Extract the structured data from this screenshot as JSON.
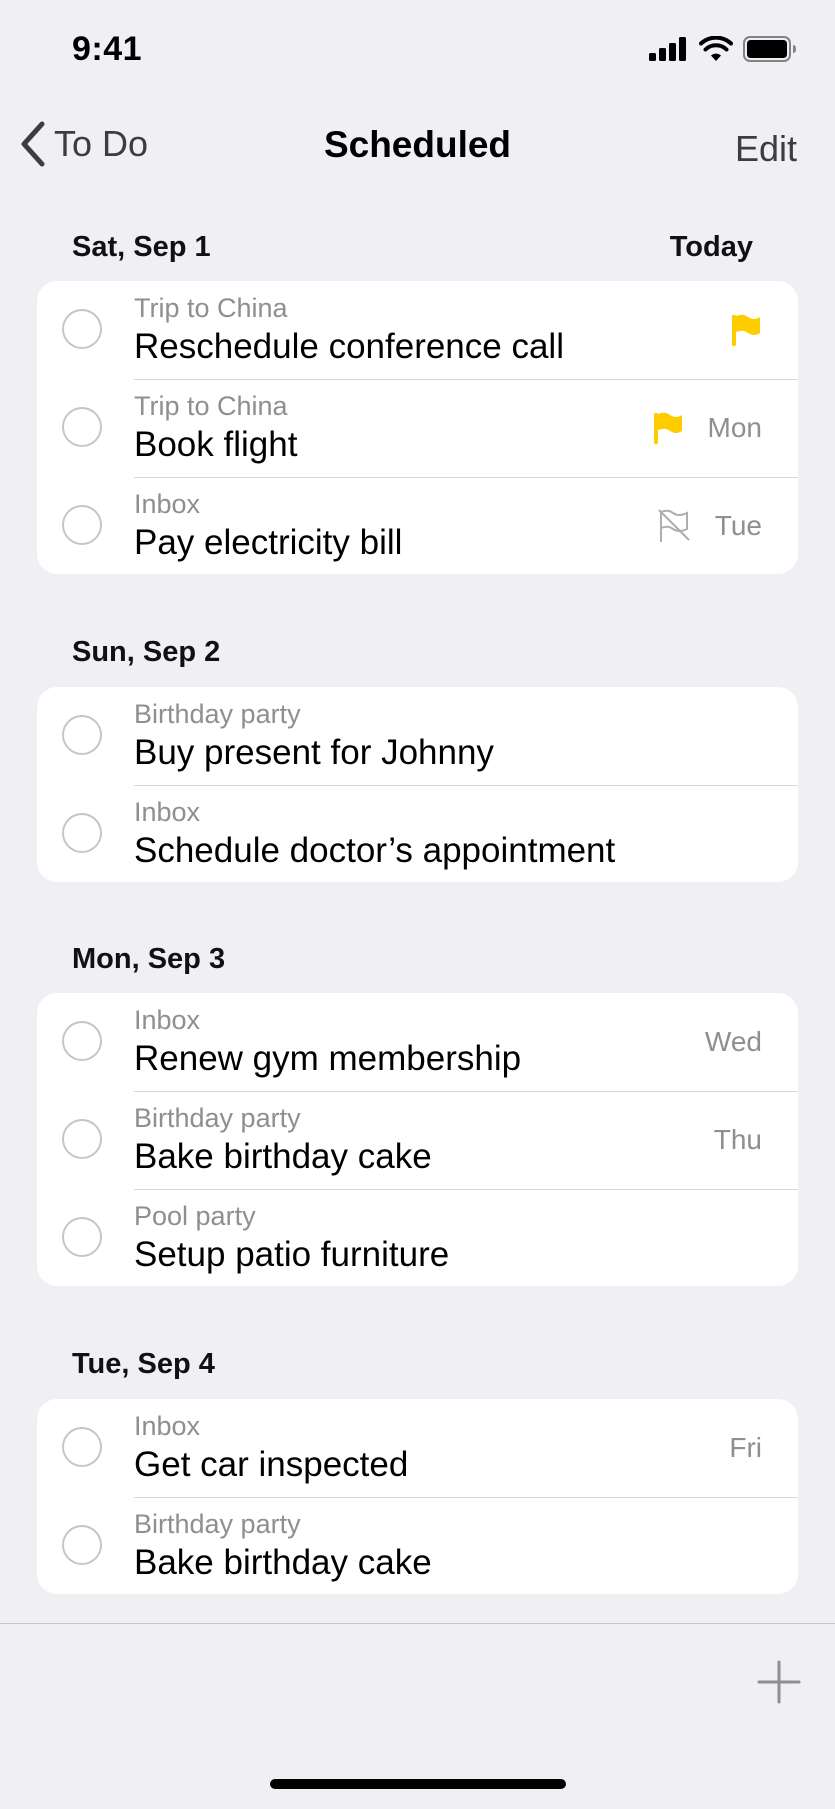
{
  "status_bar": {
    "time": "9:41",
    "icons": [
      "cellular-signal-icon",
      "wifi-icon",
      "battery-icon"
    ]
  },
  "nav": {
    "back_label": "To Do",
    "title": "Scheduled",
    "edit_label": "Edit"
  },
  "colors": {
    "background": "#efeff4",
    "card": "#ffffff",
    "flag": "#ffcc00",
    "secondary_text": "#8e8e93"
  },
  "sections": [
    {
      "date": "Sat, Sep 1",
      "right_label": "Today",
      "items": [
        {
          "project": "Trip to China",
          "title": "Reschedule conference call",
          "flag": "flagged",
          "day": ""
        },
        {
          "project": "Trip to China",
          "title": "Book flight",
          "flag": "flagged",
          "day": "Mon"
        },
        {
          "project": "Inbox",
          "title": "Pay electricity bill",
          "flag": "unflagged",
          "day": "Tue"
        }
      ]
    },
    {
      "date": "Sun, Sep 2",
      "right_label": "",
      "items": [
        {
          "project": "Birthday party",
          "title": "Buy present for Johnny",
          "flag": "none",
          "day": ""
        },
        {
          "project": "Inbox",
          "title": "Schedule doctor’s appointment",
          "flag": "none",
          "day": ""
        }
      ]
    },
    {
      "date": "Mon, Sep 3",
      "right_label": "",
      "items": [
        {
          "project": "Inbox",
          "title": "Renew gym membership",
          "flag": "none",
          "day": "Wed"
        },
        {
          "project": "Birthday party",
          "title": "Bake birthday cake",
          "flag": "none",
          "day": "Thu"
        },
        {
          "project": "Pool party",
          "title": "Setup patio furniture",
          "flag": "none",
          "day": ""
        }
      ]
    },
    {
      "date": "Tue, Sep 4",
      "right_label": "",
      "items": [
        {
          "project": "Inbox",
          "title": "Get car inspected",
          "flag": "none",
          "day": "Fri"
        },
        {
          "project": "Birthday party",
          "title": "Bake birthday cake",
          "flag": "none",
          "day": ""
        }
      ]
    }
  ],
  "toolbar": {
    "add_icon": "plus-icon"
  }
}
